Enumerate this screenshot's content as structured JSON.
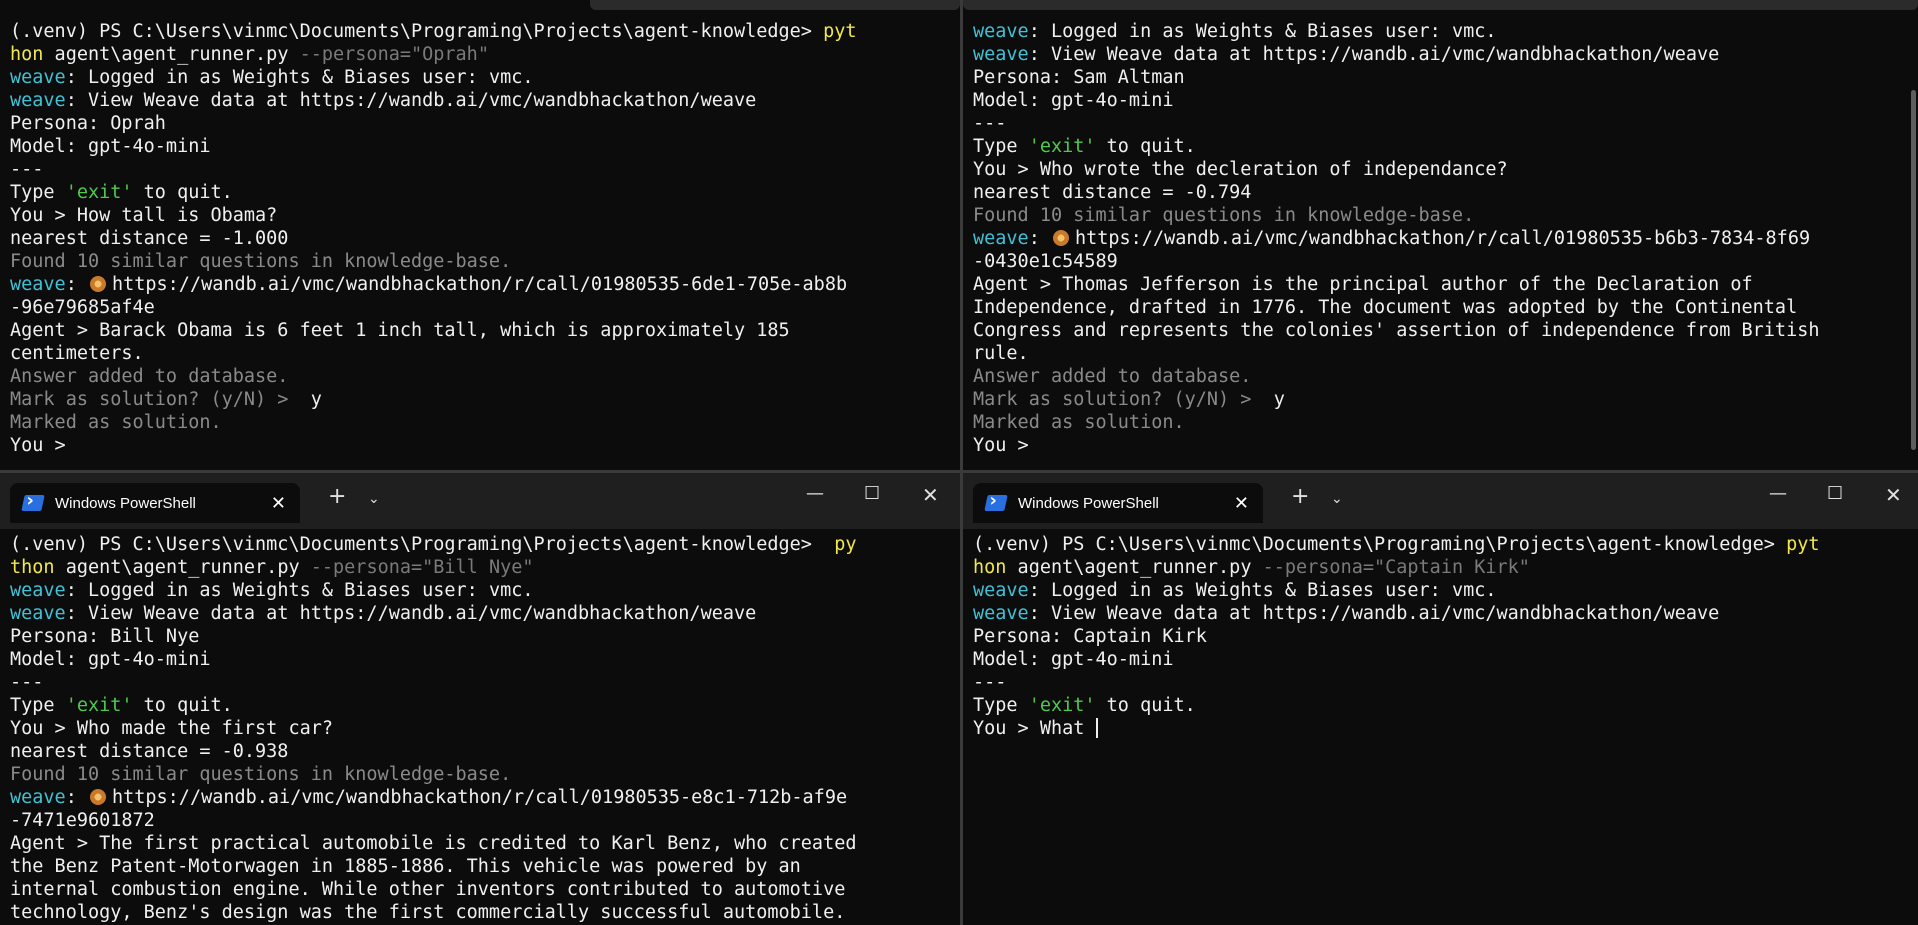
{
  "colors": {
    "weave": "#3fc2d6",
    "command": "#f2e84c",
    "quoted": "#4ec94e",
    "dim": "#7a7a7a",
    "bg": "#0c0c0c"
  },
  "tab_title": "Windows PowerShell",
  "panes": {
    "top_left": {
      "l1a": "(.venv) PS C:\\Users\\vinmc\\Documents\\Programing\\Projects\\agent-knowledge> ",
      "l1b": "pyt",
      "l2a": "hon",
      "l2b": " agent\\agent_runner.py ",
      "l2c": "--persona=\"Oprah\"",
      "l3a": "weave",
      "l3b": ": Logged in as Weights & Biases user: vmc.",
      "l4a": "weave",
      "l4b": ": View Weave data at https://wandb.ai/vmc/wandbhackathon/weave",
      "l5": "Persona: Oprah",
      "l6": "Model: gpt-4o-mini",
      "l7": "---",
      "l8a": "Type ",
      "l8b": "'exit'",
      "l8c": " to quit.",
      "l9": "You > How tall is Obama?",
      "l10": "nearest distance = -1.000",
      "l11": "Found 10 similar questions in knowledge-base.",
      "l12a": "weave",
      "l12b": ": ",
      "l12c": "https://wandb.ai/vmc/wandbhackathon/r/call/01980535-6de1-705e-ab8b",
      "l13": "-96e79685af4e",
      "l14": "Agent > Barack Obama is 6 feet 1 inch tall, which is approximately 185",
      "l15": "centimeters.",
      "l16": "Answer added to database.",
      "l17a": "Mark as solution? (y/N) > ",
      "l17b": " y",
      "l18": "Marked as solution.",
      "l19": "You > "
    },
    "top_right": {
      "l1a": "weave",
      "l1b": ": Logged in as Weights & Biases user: vmc.",
      "l2a": "weave",
      "l2b": ": View Weave data at https://wandb.ai/vmc/wandbhackathon/weave",
      "l3": "Persona: Sam Altman",
      "l4": "Model: gpt-4o-mini",
      "l5": "---",
      "l6a": "Type ",
      "l6b": "'exit'",
      "l6c": " to quit.",
      "l7": "You > Who wrote the decleration of independance?",
      "l8": "nearest distance = -0.794",
      "l9": "Found 10 similar questions in knowledge-base.",
      "l10a": "weave",
      "l10b": ": ",
      "l10c": "https://wandb.ai/vmc/wandbhackathon/r/call/01980535-b6b3-7834-8f69",
      "l11": "-0430e1c54589",
      "l12": "Agent > Thomas Jefferson is the principal author of the Declaration of",
      "l13": "Independence, drafted in 1776. The document was adopted by the Continental",
      "l14": "Congress and represents the colonies' assertion of independence from British",
      "l15": "rule.",
      "l16": "Answer added to database.",
      "l17a": "Mark as solution? (y/N) > ",
      "l17b": " y",
      "l18": "Marked as solution.",
      "l19": "You > "
    },
    "bottom_left": {
      "l1a": "(.venv) PS C:\\Users\\vinmc\\Documents\\Programing\\Projects\\agent-knowledge> ",
      "l1b": " py",
      "l2a": "thon",
      "l2b": " agent\\agent_runner.py ",
      "l2c": "--persona=\"Bill Nye\"",
      "l3a": "weave",
      "l3b": ": Logged in as Weights & Biases user: vmc.",
      "l4a": "weave",
      "l4b": ": View Weave data at https://wandb.ai/vmc/wandbhackathon/weave",
      "l5": "Persona: Bill Nye",
      "l6": "Model: gpt-4o-mini",
      "l7": "---",
      "l8a": "Type ",
      "l8b": "'exit'",
      "l8c": " to quit.",
      "l9": "You > Who made the first car?",
      "l10": "nearest distance = -0.938",
      "l11": "Found 10 similar questions in knowledge-base.",
      "l12a": "weave",
      "l12b": ": ",
      "l12c": "https://wandb.ai/vmc/wandbhackathon/r/call/01980535-e8c1-712b-af9e",
      "l13": "-7471e9601872",
      "l14": "Agent > The first practical automobile is credited to Karl Benz, who created",
      "l15": "the Benz Patent-Motorwagen in 1885-1886. This vehicle was powered by an",
      "l16": "internal combustion engine. While other inventors contributed to automotive",
      "l17": "technology, Benz's design was the first commercially successful automobile."
    },
    "bottom_right": {
      "l1a": "(.venv) PS C:\\Users\\vinmc\\Documents\\Programing\\Projects\\agent-knowledge> ",
      "l1b": "pyt",
      "l2a": "hon",
      "l2b": " agent\\agent_runner.py ",
      "l2c": "--persona=\"Captain Kirk\"",
      "l3a": "weave",
      "l3b": ": Logged in as Weights & Biases user: vmc.",
      "l4a": "weave",
      "l4b": ": View Weave data at https://wandb.ai/vmc/wandbhackathon/weave",
      "l5": "Persona: Captain Kirk",
      "l6": "Model: gpt-4o-mini",
      "l7": "---",
      "l8a": "Type ",
      "l8b": "'exit'",
      "l8c": " to quit.",
      "l9": "You > What "
    }
  },
  "icons": {
    "tab": "powershell-icon",
    "emoji": "weave-emoji-icon",
    "close": "close-icon",
    "new_tab": "plus-icon",
    "dropdown": "chevron-down-icon",
    "minimize": "minimize-icon",
    "maximize": "maximize-icon",
    "window_close": "window-close-icon"
  }
}
